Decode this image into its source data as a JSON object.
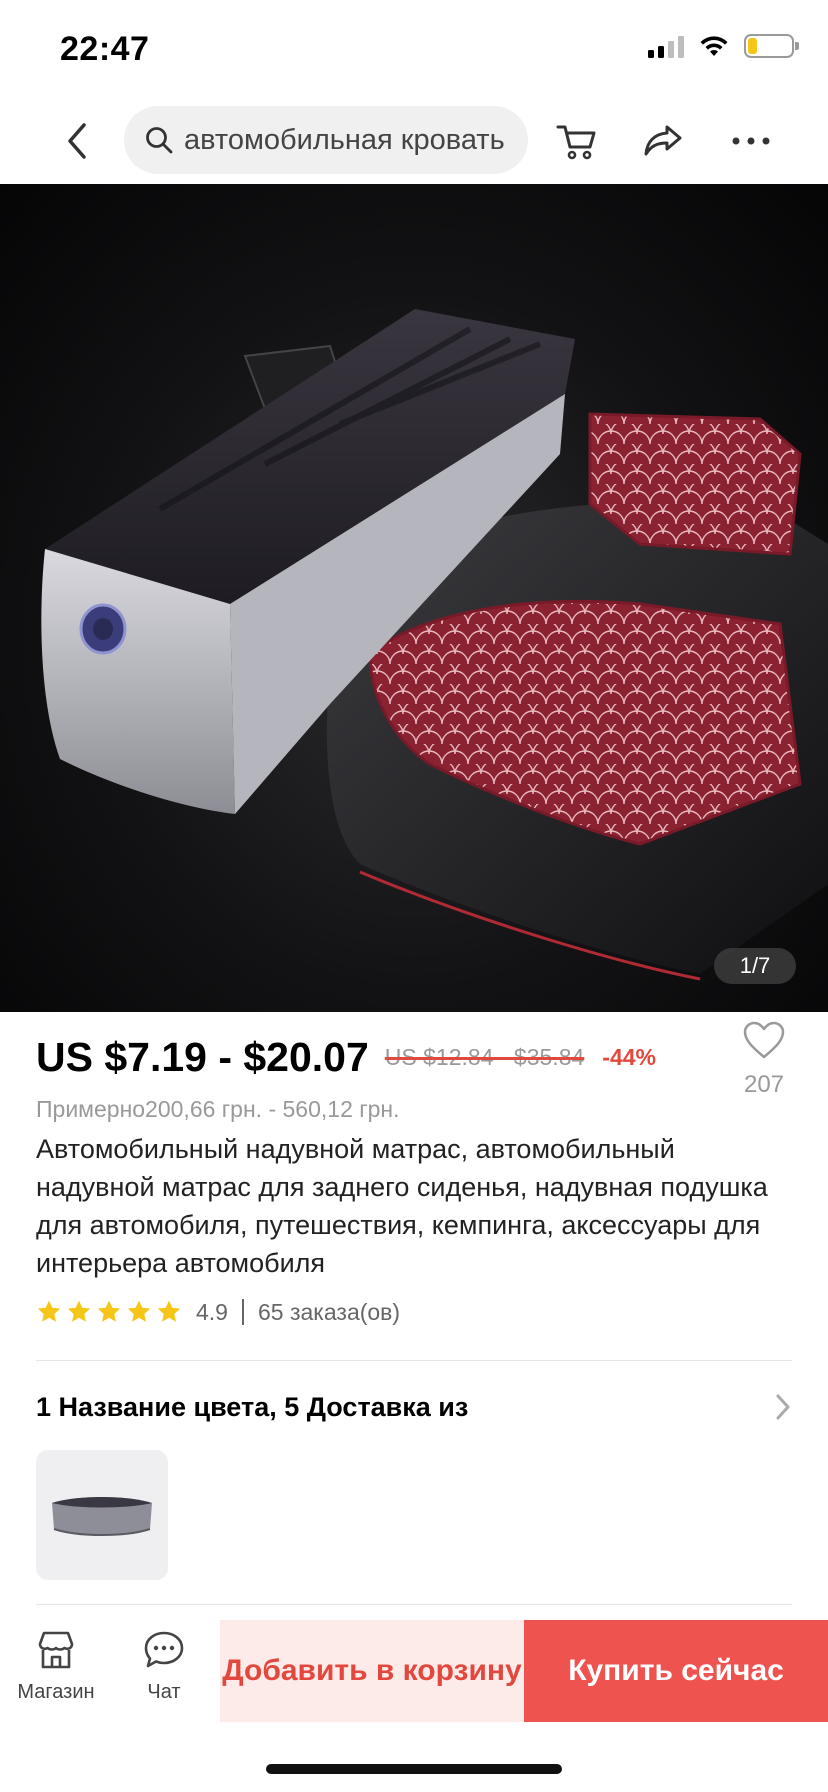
{
  "status_bar": {
    "time": "22:47",
    "battery_fraction": 0.2
  },
  "nav": {
    "search_text": "автомобильная кровать",
    "icons": [
      "back-chevron-icon",
      "search-icon",
      "cart-icon",
      "share-icon",
      "more-icon"
    ]
  },
  "gallery": {
    "counter": "1/7"
  },
  "product": {
    "price": "US $7.19 - $20.07",
    "old_price": "US $12.84 - $35.84",
    "discount": "-44%",
    "wishlist_count": "207",
    "approx_price": "Примерно200,66 грн. - 560,12 грн.",
    "title": "Автомобильный надувной матрас, автомобильный надувной матрас для заднего сиденья, надувная подушка для автомобиля, путешествия, кемпинга, аксессуары для интерьера автомобиля",
    "rating": "4.9",
    "stars": 5,
    "orders": "65 заказа(ов)"
  },
  "options": {
    "label": "1 Название цвета, 5 Доставка из"
  },
  "bottom_bar": {
    "store_label": "Магазин",
    "chat_label": "Чат",
    "add_to_cart": "Добавить в корзину",
    "buy_now": "Купить сейчас"
  },
  "colors": {
    "accent": "#ef5350",
    "accent_text": "#e2483d",
    "cart_bg": "#fdebea",
    "star": "#f5c518"
  }
}
